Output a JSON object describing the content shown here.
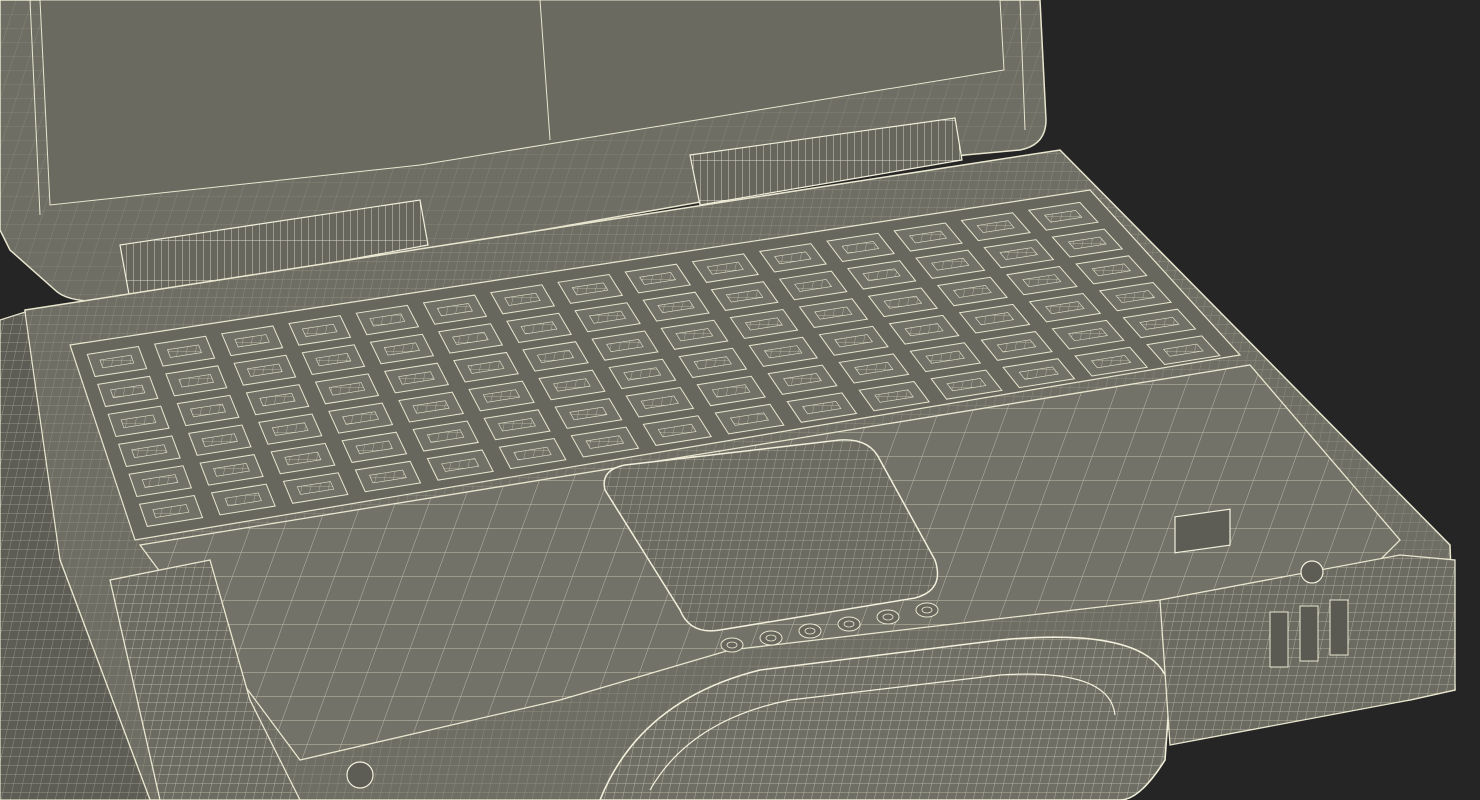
{
  "scene": {
    "subject": "rugged-laptop-wireframe",
    "colors": {
      "background": "#252525",
      "surface": "#6e6e64",
      "surface_dark": "#5d5d55",
      "surface_light": "#7a7a70",
      "wire": "#e9e6cf",
      "wire_dense": "#f2efdb"
    },
    "keyboard": {
      "rows": 6,
      "keys_per_row": 15
    },
    "status_leds": 6,
    "side_ports": 3
  }
}
